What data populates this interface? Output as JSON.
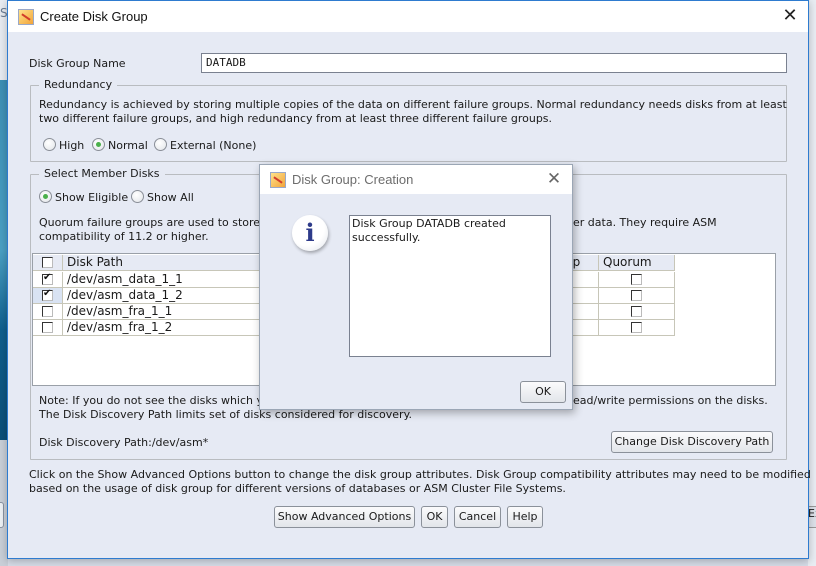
{
  "background": {
    "left_letter": "S",
    "right_button_partial": "Ex"
  },
  "window": {
    "title": "Create Disk Group",
    "close_icon": "close-icon"
  },
  "disk_group_name": {
    "label": "Disk Group Name",
    "value": "DATADB"
  },
  "redundancy": {
    "title": "Redundancy",
    "description_line1": "Redundancy is achieved by storing multiple copies of the data on different failure groups. Normal redundancy needs disks from at least",
    "description_line2": "two different failure groups, and high redundancy from at least three different failure groups.",
    "options": [
      {
        "label": "High",
        "selected": false
      },
      {
        "label": "Normal",
        "selected": true
      },
      {
        "label": "External (None)",
        "selected": false
      }
    ]
  },
  "member_disks": {
    "title": "Select Member Disks",
    "filter_options": [
      {
        "label": "Show Eligible",
        "selected": true
      },
      {
        "label": "Show All",
        "selected": false
      }
    ],
    "quorum_text_left_line1": "Quorum failure groups are used to store",
    "quorum_text_right_line1": "er data. They require ASM",
    "quorum_text_line2": "compatibility of 11.2 or higher.",
    "table": {
      "columns": [
        "",
        "Disk Path",
        "roup",
        "Quorum"
      ],
      "rows": [
        {
          "checked": true,
          "path": "/dev/asm_data_1_1",
          "quorum": false
        },
        {
          "checked": true,
          "path": "/dev/asm_data_1_2",
          "quorum": false
        },
        {
          "checked": false,
          "path": "/dev/asm_fra_1_1",
          "quorum": false
        },
        {
          "checked": false,
          "path": "/dev/asm_fra_1_2",
          "quorum": false
        }
      ]
    },
    "note_left_line1": "Note: If you do not see the disks which yo",
    "note_right_line1": "ead/write permissions on the disks.",
    "note_line2": "The Disk Discovery Path limits set of disks considered for discovery.",
    "discovery_path_label": "Disk Discovery Path:/dev/asm*",
    "change_path_button": "Change Disk Discovery Path"
  },
  "advanced_note_line1": "Click on the Show Advanced Options button to change the disk group attributes. Disk Group compatibility attributes may need to be modified",
  "advanced_note_line2": "based on the usage of disk group for different versions of databases or ASM Cluster File Systems.",
  "buttons": {
    "show_advanced": "Show Advanced Options",
    "ok": "OK",
    "cancel": "Cancel",
    "help": "Help"
  },
  "modal": {
    "title": "Disk Group: Creation",
    "message": "Disk Group DATADB created\nsuccessfully.",
    "ok_button": "OK",
    "icon": "info-icon",
    "icon_glyph": "i"
  }
}
